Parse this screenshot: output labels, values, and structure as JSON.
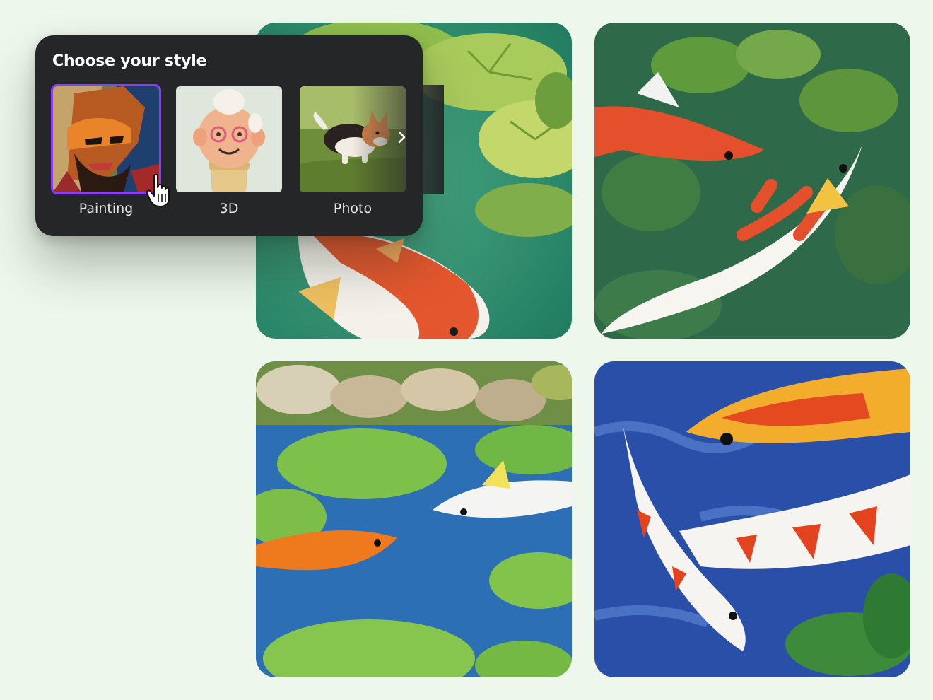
{
  "style_picker": {
    "title": "Choose your style",
    "selected": "Painting",
    "options": [
      {
        "label": "Painting",
        "icon": "painting-thumbnail"
      },
      {
        "label": "3D",
        "icon": "3d-character-thumbnail"
      },
      {
        "label": "Photo",
        "icon": "corgi-photo-thumbnail"
      }
    ],
    "next_icon": "chevron-right-icon",
    "accent": "#8b3dff"
  },
  "results": [
    {
      "icon": "koi-watercolor-image"
    },
    {
      "icon": "koi-watercolor-image"
    },
    {
      "icon": "koi-pond-image"
    },
    {
      "icon": "koi-blue-water-image"
    }
  ],
  "cursor": {
    "icon": "hand-pointer-icon"
  }
}
